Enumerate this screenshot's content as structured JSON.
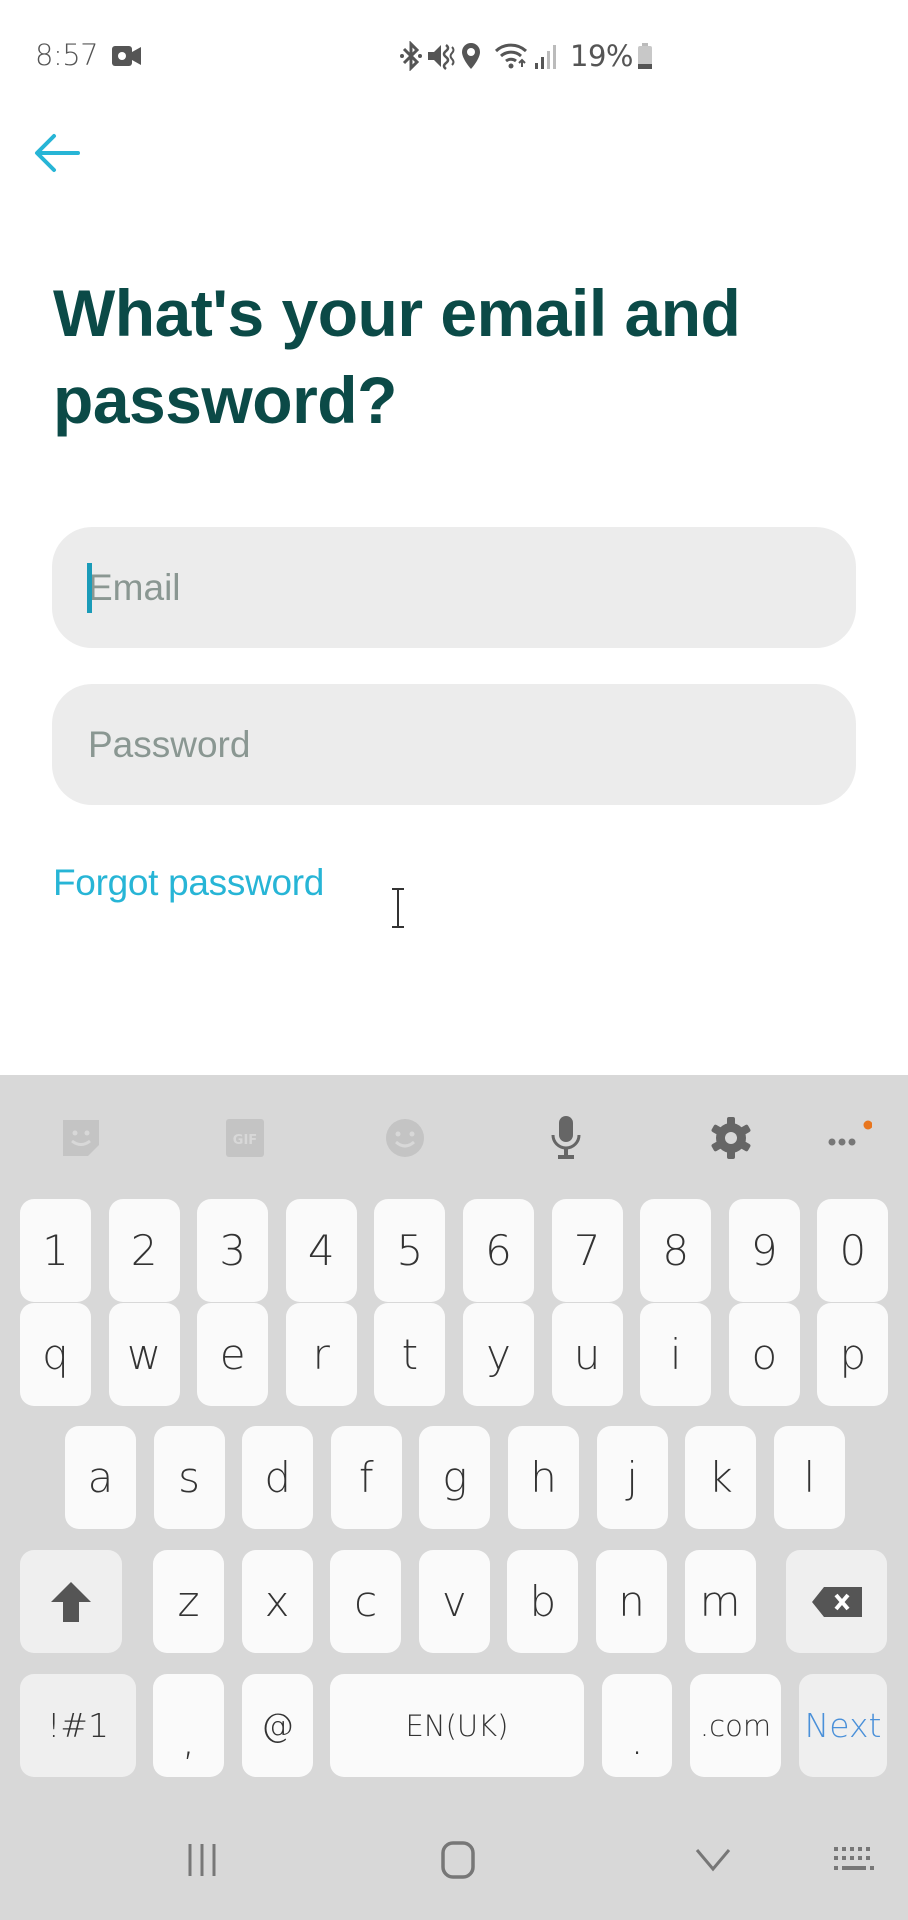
{
  "status_bar": {
    "time": "8:57",
    "battery_percent": "19%",
    "icons": [
      "video-camera-icon",
      "bluetooth-icon",
      "vibrate-icon",
      "location-icon",
      "wifi-icon",
      "signal-icon",
      "battery-icon"
    ]
  },
  "header": {
    "back_icon": "arrow-left-icon",
    "title": "What's your email and password?"
  },
  "form": {
    "email": {
      "value": "",
      "placeholder": "Email"
    },
    "password": {
      "value": "",
      "placeholder": "Password"
    },
    "forgot_password_label": "Forgot password"
  },
  "colors": {
    "title": "#0b4a47",
    "accent": "#27b5d6",
    "field_bg": "#ececec",
    "keyboard_bg": "#d8d8d8",
    "next_key": "#4a90d9",
    "notification_dot": "#e8761e"
  },
  "keyboard": {
    "toolbar": [
      "sticker-icon",
      "gif-icon",
      "emoji-icon",
      "microphone-icon",
      "settings-gear-icon",
      "more-options-icon"
    ],
    "rows": {
      "numbers": [
        "1",
        "2",
        "3",
        "4",
        "5",
        "6",
        "7",
        "8",
        "9",
        "0"
      ],
      "row1": [
        "q",
        "w",
        "e",
        "r",
        "t",
        "y",
        "u",
        "i",
        "o",
        "p"
      ],
      "row2": [
        "a",
        "s",
        "d",
        "f",
        "g",
        "h",
        "j",
        "k",
        "l"
      ],
      "row3": [
        "z",
        "x",
        "c",
        "v",
        "b",
        "n",
        "m"
      ]
    },
    "symbols_label": "!#1",
    "comma": ",",
    "at": "@",
    "space_label": "EN(UK)",
    "period": ".",
    "dotcom": ".com",
    "next_label": "Next"
  },
  "nav_bar": [
    "recent-apps-icon",
    "home-icon",
    "hide-keyboard-icon",
    "keyboard-switch-icon"
  ]
}
